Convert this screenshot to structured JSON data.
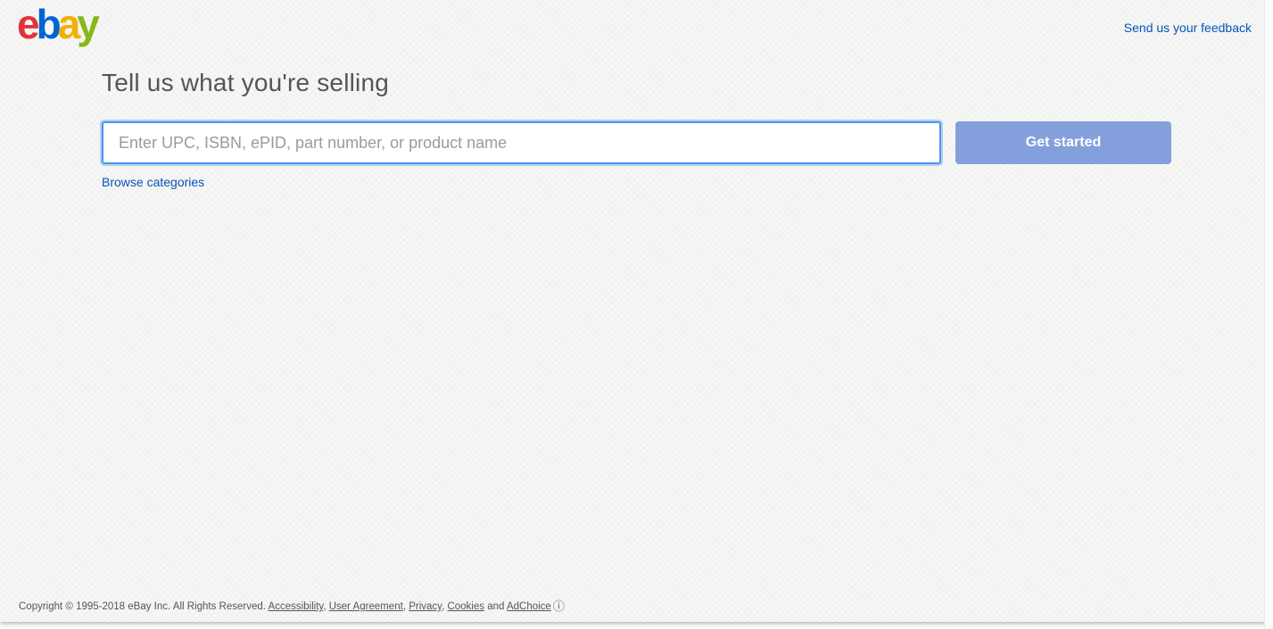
{
  "header": {
    "logo": {
      "label": "ebay",
      "letters": [
        {
          "char": "e",
          "color": "#e53238"
        },
        {
          "char": "b",
          "color": "#0064d2"
        },
        {
          "char": "a",
          "color": "#f5af02"
        },
        {
          "char": "y",
          "color": "#86b817"
        }
      ]
    },
    "feedback_link_label": "Send us your feedback"
  },
  "main": {
    "title": "Tell us what you're selling",
    "search": {
      "placeholder": "Enter UPC, ISBN, ePID, part number, or product name",
      "value": ""
    },
    "get_started_label": "Get started",
    "browse_categories_label": "Browse categories"
  },
  "footer": {
    "copyright_text": "Copyright © 1995-2018 eBay Inc. All Rights Reserved.",
    "links": [
      "Accessibility",
      "User Agreement",
      "Privacy",
      "Cookies"
    ],
    "separator": ",",
    "and_text": "and",
    "adchoice_label": "AdChoice",
    "adchoice_icon_glyph": "ⓘ"
  },
  "colors": {
    "page_background": "#f4f4f3",
    "link_blue": "#0654ba",
    "button_background": "#84a0dc",
    "input_focus_border": "#4a95ef",
    "heading_text": "#555555",
    "footer_text": "#555555",
    "placeholder_text": "#9b9b9b"
  }
}
